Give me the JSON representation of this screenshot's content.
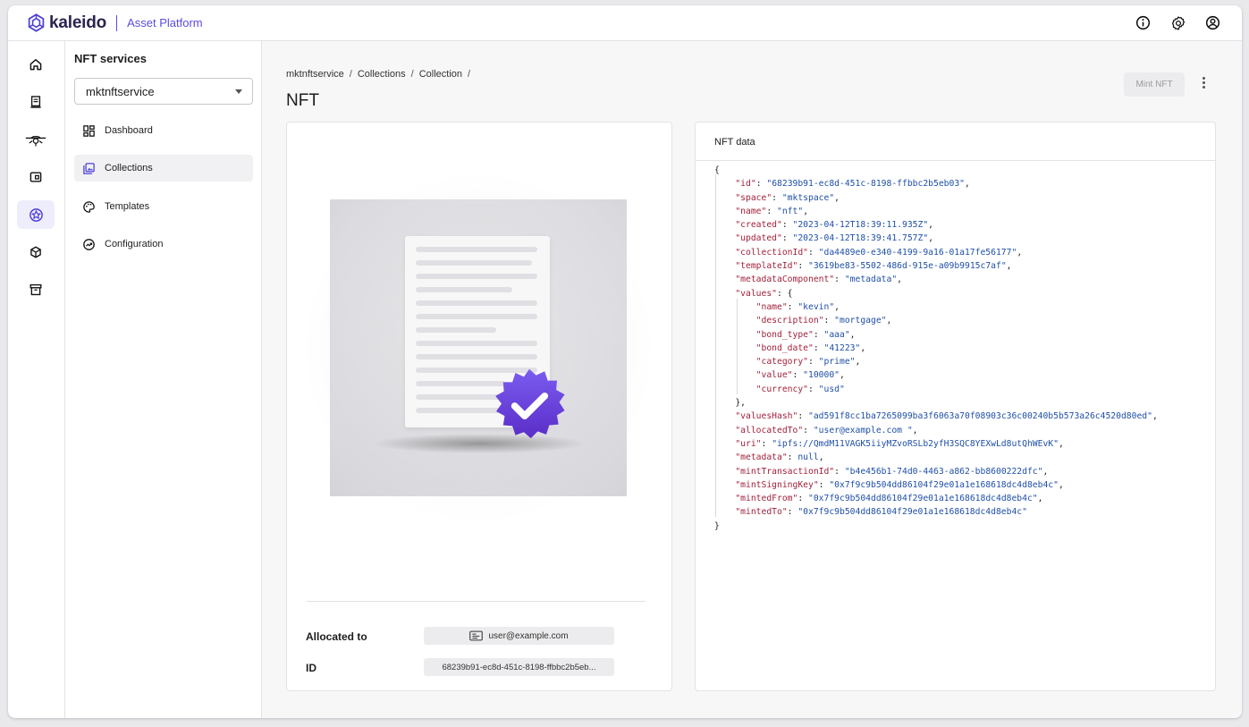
{
  "app": {
    "brand": "kaleido",
    "product": "Asset Platform"
  },
  "colors": {
    "accent": "#5b4ce3",
    "badge_top": "#7b5cf0",
    "badge_bottom": "#5a2dc8"
  },
  "top_icons": [
    "info-icon",
    "gear-icon",
    "account-icon"
  ],
  "rail": {
    "items": [
      {
        "name": "home-icon",
        "active": false
      },
      {
        "name": "ledger-icon",
        "active": false
      },
      {
        "name": "network-icon",
        "active": false
      },
      {
        "name": "wallet-icon",
        "active": false
      },
      {
        "name": "nft-badge-icon",
        "active": true
      },
      {
        "name": "cube-icon",
        "active": false
      },
      {
        "name": "archive-icon",
        "active": false
      }
    ]
  },
  "sidenav": {
    "title": "NFT services",
    "selected_service": "mktnftservice",
    "items": [
      {
        "label": "Dashboard",
        "icon": "dashboard-icon",
        "active": false
      },
      {
        "label": "Collections",
        "icon": "collections-icon",
        "active": true
      },
      {
        "label": "Templates",
        "icon": "palette-icon",
        "active": false
      },
      {
        "label": "Configuration",
        "icon": "configuration-icon",
        "active": false
      }
    ]
  },
  "main": {
    "breadcrumb": [
      "mktnftservice",
      "Collections",
      "Collection"
    ],
    "breadcrumb_sep": "/",
    "title": "NFT",
    "mint_label": "Mint NFT"
  },
  "details": {
    "allocated_label": "Allocated to",
    "allocated_value": "user@example.com",
    "id_label": "ID",
    "id_value": "68239b91-ec8d-451c-8198-ffbbc2b5eb..."
  },
  "nft_data": {
    "header": "NFT data",
    "open_brace": "{",
    "close_brace": "}",
    "entries": [
      {
        "key": "id",
        "value": "68239b91-ec8d-451c-8198-ffbbc2b5eb03"
      },
      {
        "key": "space",
        "value": "mktspace"
      },
      {
        "key": "name",
        "value": "nft"
      },
      {
        "key": "created",
        "value": "2023-04-12T18:39:11.935Z"
      },
      {
        "key": "updated",
        "value": "2023-04-12T18:39:41.757Z"
      },
      {
        "key": "collectionId",
        "value": "da4489e0-e340-4199-9a16-01a17fe56177"
      },
      {
        "key": "templateId",
        "value": "3619be83-5502-486d-915e-a09b9915c7af"
      },
      {
        "key": "metadataComponent",
        "value": "metadata"
      }
    ],
    "values_key": "values",
    "values": [
      {
        "key": "name",
        "value": "kevin"
      },
      {
        "key": "description",
        "value": "mortgage"
      },
      {
        "key": "bond_type",
        "value": "aaa"
      },
      {
        "key": "bond_date",
        "value": "41223"
      },
      {
        "key": "category",
        "value": "prime"
      },
      {
        "key": "value",
        "value": "10000"
      },
      {
        "key": "currency",
        "value": "usd"
      }
    ],
    "entries_after": [
      {
        "key": "valuesHash",
        "value": "ad591f8cc1ba7265099ba3f6063a70f08903c36c00240b5b573a26c4520d80ed"
      },
      {
        "key": "allocatedTo",
        "value": "user@example.com ",
        "raw_tail": ","
      },
      {
        "key": "uri",
        "value": "ipfs://QmdM11VAGK5iiyMZvoRSLb2yfH3SQC8YEXwLd8utQhWEvK"
      },
      {
        "key": "metadata",
        "value": null
      },
      {
        "key": "mintTransactionId",
        "value": "b4e456b1-74d0-4463-a862-bb8600222dfc"
      },
      {
        "key": "mintSigningKey",
        "value": "0x7f9c9b504dd86104f29e01a1e168618dc4d8eb4c"
      },
      {
        "key": "mintedFrom",
        "value": "0x7f9c9b504dd86104f29e01a1e168618dc4d8eb4c"
      },
      {
        "key": "mintedTo",
        "value": "0x7f9c9b504dd86104f29e01a1e168618dc4d8eb4c"
      }
    ]
  }
}
